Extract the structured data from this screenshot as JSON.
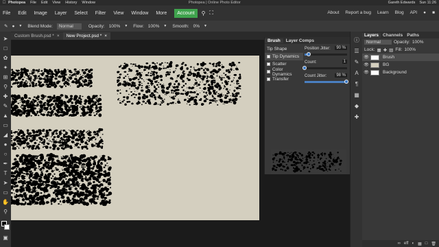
{
  "mac_menu": {
    "app": "Photopea",
    "items": [
      "File",
      "Edit",
      "View",
      "History",
      "Window"
    ],
    "title": "Photopea | Online Photo Editor",
    "user": "Gareth Edwards",
    "clock": "Sun 11:26"
  },
  "app_menu": {
    "items": [
      "File",
      "Edit",
      "Image",
      "Layer",
      "Select",
      "Filter",
      "View",
      "Window",
      "More"
    ],
    "account": "Account",
    "right_items": [
      "About",
      "Report a bug",
      "Learn",
      "Blog",
      "API"
    ]
  },
  "options": {
    "blend_mode_label": "Blend Mode:",
    "blend_mode_value": "Normal",
    "opacity_label": "Opacity:",
    "opacity_value": "100%",
    "flow_label": "Flow:",
    "flow_value": "100%",
    "smooth_label": "Smooth:",
    "smooth_value": "0%"
  },
  "tabs": [
    {
      "label": "Custom Brush.psd *",
      "close": "×"
    },
    {
      "label": "New Project.psd *",
      "close": "×"
    }
  ],
  "brush_panel": {
    "tabs": [
      "Brush",
      "Layer Comps"
    ],
    "sections": [
      {
        "label": "Tip Shape",
        "checkbox": false
      },
      {
        "label": "Tip Dynamics",
        "checkbox": true,
        "checked": true,
        "selected": true
      },
      {
        "label": "Scatter",
        "checkbox": true,
        "checked": true
      },
      {
        "label": "Color Dynamics",
        "checkbox": true,
        "checked": false
      },
      {
        "label": "Transfer",
        "checkbox": true,
        "checked": false
      }
    ],
    "params": [
      {
        "label": "Position Jitter:",
        "value": "90 %",
        "level": 0.1
      },
      {
        "label": "Count:",
        "value": "1",
        "level": 0.0
      },
      {
        "label": "Count Jitter:",
        "value": "98 %",
        "level": 0.98
      }
    ]
  },
  "layers_panel": {
    "tabs": [
      "Layers",
      "Channels",
      "Paths"
    ],
    "blend": "Normal",
    "opacity_label": "Opacity:",
    "opacity_value": "100%",
    "lock_label": "Lock:",
    "fill_label": "Fill:",
    "fill_value": "100%",
    "layers": [
      {
        "name": "Brush",
        "selected": true,
        "thumb": "#ffffff"
      },
      {
        "name": "BG",
        "selected": false,
        "thumb": "#d4cfbf"
      },
      {
        "name": "Background",
        "selected": false,
        "thumb": "#ffffff"
      }
    ],
    "footer": [
      "eff"
    ]
  },
  "colors": {
    "canvas": "#d4cfbf",
    "accent": "#3fa34d",
    "slider": "#3a78c4"
  }
}
